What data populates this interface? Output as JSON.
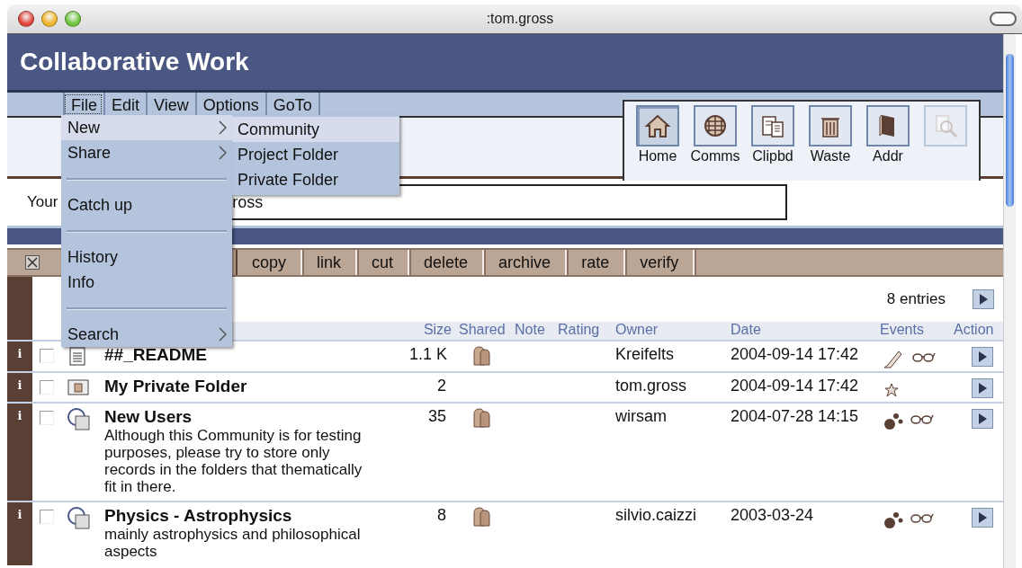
{
  "window": {
    "title": ":tom.gross"
  },
  "header": {
    "title": "Collaborative Work"
  },
  "menubar": [
    {
      "label": "File",
      "selected": true
    },
    {
      "label": "Edit",
      "selected": false
    },
    {
      "label": "View",
      "selected": false
    },
    {
      "label": "Options",
      "selected": false
    },
    {
      "label": "GoTo",
      "selected": false
    }
  ],
  "file_menu": [
    {
      "kind": "item",
      "label": "New",
      "submenu": true,
      "selected": true
    },
    {
      "kind": "item",
      "label": "Share",
      "submenu": true,
      "selected": false
    },
    {
      "kind": "separator"
    },
    {
      "kind": "item",
      "label": "Catch up",
      "submenu": false,
      "selected": false
    },
    {
      "kind": "separator"
    },
    {
      "kind": "item",
      "label": "History",
      "submenu": false,
      "selected": false
    },
    {
      "kind": "item",
      "label": "Info",
      "submenu": false,
      "selected": false
    },
    {
      "kind": "separator"
    },
    {
      "kind": "item",
      "label": "Search",
      "submenu": true,
      "selected": false
    }
  ],
  "submenu": [
    {
      "label": "Community",
      "selected": true
    },
    {
      "label": "Project Folder",
      "selected": false
    },
    {
      "label": "Private Folder",
      "selected": false
    }
  ],
  "nav_icons": [
    {
      "kind": "home",
      "label": "Home",
      "selected": true,
      "disabled": false
    },
    {
      "kind": "globe",
      "label": "Comms",
      "selected": false,
      "disabled": false
    },
    {
      "kind": "clipboard",
      "label": "Clipbd",
      "selected": false,
      "disabled": false
    },
    {
      "kind": "trash",
      "label": "Waste",
      "selected": false,
      "disabled": false
    },
    {
      "kind": "book",
      "label": "Addr",
      "selected": false,
      "disabled": false
    },
    {
      "kind": "search",
      "selected": false,
      "disabled": true
    }
  ],
  "user_field": {
    "label": "Your",
    "value": "ross"
  },
  "select_all": {
    "checked": true
  },
  "actions": [
    "copy",
    "link",
    "cut",
    "delete",
    "archive",
    "rate",
    "verify"
  ],
  "list": {
    "count": "8 entries",
    "columns": [
      "Size",
      "Shared",
      "Note",
      "Rating",
      "Owner",
      "Date",
      "Events",
      "Action"
    ],
    "rows": [
      {
        "kind": "document",
        "name": "##_README",
        "size": "1.1 K",
        "shared": true,
        "owner": "Kreifelts",
        "date": "2004-09-14 17:42",
        "events": [
          {
            "kind": "pencil"
          },
          {
            "kind": "glasses"
          }
        ],
        "info": "i",
        "checked": false
      },
      {
        "kind": "private-folder",
        "name": "My Private Folder",
        "size": "2",
        "shared": false,
        "owner": "tom.gross",
        "date": "2004-09-14 17:42",
        "events": [
          {
            "kind": "star"
          }
        ],
        "info": "i",
        "checked": false
      },
      {
        "kind": "community",
        "name": "New Users",
        "description": "Although this Community is for testing purposes, please try to store only records in the folders that thematically fit in there.",
        "size": "35",
        "shared": true,
        "owner": "wirsam",
        "date": "2004-07-28 14:15",
        "events": [
          {
            "kind": "dots"
          },
          {
            "kind": "glasses"
          }
        ],
        "info": "i",
        "checked": false
      },
      {
        "kind": "community",
        "name": "Physics - Astrophysics",
        "description": "mainly astrophysics and philosophical aspects",
        "size": "8",
        "shared": true,
        "owner": "silvio.caizzi",
        "date": "2003-03-24",
        "events": [
          {
            "kind": "dots"
          },
          {
            "kind": "glasses"
          }
        ],
        "info": "i",
        "checked": false
      }
    ]
  }
}
